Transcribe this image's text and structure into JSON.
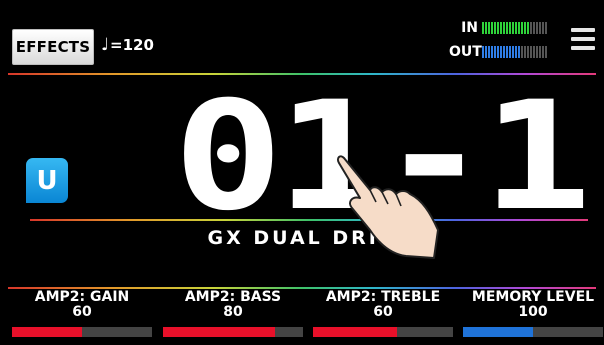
{
  "header": {
    "effects_label": "EFFECTS",
    "tempo_note": "♩",
    "tempo_text": "=120",
    "in_label": "IN",
    "out_label": "OUT",
    "in_level": 0.72,
    "out_level": 0.6,
    "in_color": "#2fd43a",
    "out_color": "#2f7de6"
  },
  "patch": {
    "user_badge": "U",
    "number": "01-1",
    "name": "GX DUAL DRIVE"
  },
  "params": [
    {
      "name": "AMP2: GAIN",
      "value": "60",
      "level": 0.5,
      "color": "#e8102a"
    },
    {
      "name": "AMP2: BASS",
      "value": "80",
      "level": 0.8,
      "color": "#e8102a"
    },
    {
      "name": "AMP2: TREBLE",
      "value": "60",
      "level": 0.6,
      "color": "#e8102a"
    },
    {
      "name": "MEMORY LEVEL",
      "value": "100",
      "level": 0.5,
      "color": "#1f73d9"
    }
  ]
}
